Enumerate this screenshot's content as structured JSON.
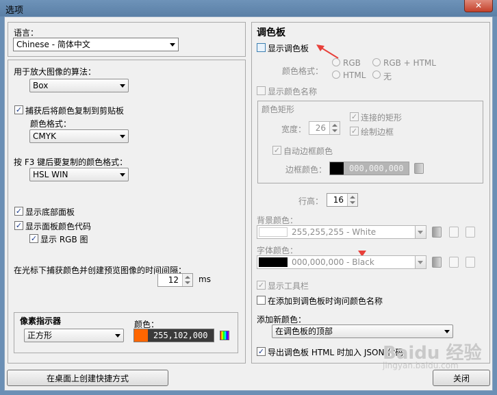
{
  "window": {
    "title": "选项",
    "close_glyph": "✕"
  },
  "left": {
    "language_label": "语言：",
    "language_value": "Chinese - 简体中文",
    "zoom_algo_label": "用于放大图像的算法：",
    "zoom_algo_value": "Box",
    "copy_after_capture_label": "捕获后将颜色复制到剪贴板",
    "copy_format_label": "颜色格式：",
    "copy_format_value": "CMYK",
    "f3_label": "按 F3 键后要复制的颜色格式：",
    "f3_value": "HSL WIN",
    "show_bottom_panel": "显示底部面板",
    "show_panel_code": "显示面板颜色代码",
    "show_rgb_graph": "显示 RGB 图",
    "interval_label": "在光标下捕获颜色并创建预览图像的时间间隔：",
    "interval_value": "12",
    "interval_unit": "ms",
    "pixel_indicator_title": "像素指示器",
    "pixel_shape_value": "正方形",
    "pixel_color_label": "颜色：",
    "pixel_color_value": "255,102,000",
    "desktop_shortcut_button": "在桌面上创建快捷方式"
  },
  "right": {
    "palette_title": "调色板",
    "show_palette": "显示调色板",
    "color_format_label": "颜色格式：",
    "fmt_rgb": "RGB",
    "fmt_rgb_html": "RGB + HTML",
    "fmt_html": "HTML",
    "fmt_none": "无",
    "show_color_names": "显示颜色名称",
    "color_rect_title": "颜色矩形",
    "width_label": "宽度：",
    "width_value": "26",
    "connected_rect": "连接的矩形",
    "draw_border": "绘制边框",
    "auto_border_color": "自动边框颜色",
    "border_color_label": "边框颜色：",
    "border_color_value": "000,000,000",
    "rows_label": "行高：",
    "rows_value": "16",
    "bg_color_label": "背景颜色：",
    "bg_color_value": "255,255,255 - White",
    "font_color_label": "字体颜色：",
    "font_color_value": "000,000,000 - Black",
    "show_toolbar": "显示工具栏",
    "ask_name": "在添加到调色板时询问颜色名称",
    "add_new_label": "添加新颜色：",
    "add_new_value": "在调色板的顶部",
    "export_json": "导出调色板 HTML 时加入 JSON 代码",
    "close_button": "关闭"
  },
  "watermark": {
    "brand": "Baidu 经验",
    "url": "jingyan.baidu.com"
  },
  "colors": {
    "pixel_swatch": "#ff6600",
    "annotation": "#e8403a"
  }
}
